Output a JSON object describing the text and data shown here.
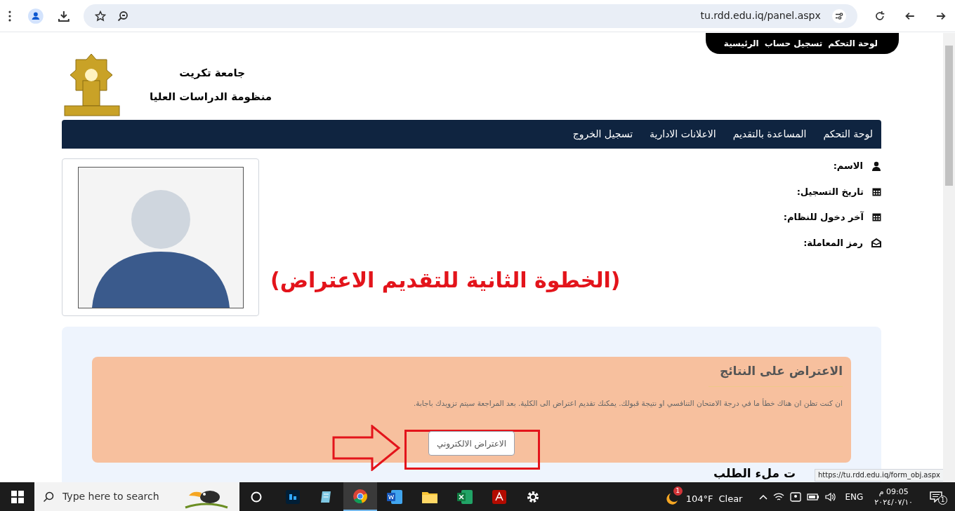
{
  "browser": {
    "url": "tu.rdd.edu.iq/panel.aspx",
    "status_url": "https://tu.rdd.edu.iq/form_obj.aspx"
  },
  "top_links": [
    "لوحة التحكم",
    "تسجيل حساب",
    "الرئيسية"
  ],
  "header": {
    "university": "جامعة تكريت",
    "system": "منظومة الدراسات العليا"
  },
  "nav": [
    "لوحة التحكم",
    "المساعدة بالتقديم",
    "الاعلانات الادارية",
    "تسجيل الخروج"
  ],
  "profile_fields": [
    {
      "kind": "user",
      "label": "الاسم:"
    },
    {
      "kind": "calendar",
      "label": "تاريخ التسجيل:"
    },
    {
      "kind": "calendar",
      "label": "آخر دخول للنظام:"
    },
    {
      "kind": "envelope",
      "label": "رمز المعاملة:"
    }
  ],
  "annotation": "(الخطوة الثانية للتقديم الاعتراض)",
  "objection": {
    "title": "الاعتراض على النتائج",
    "text": "ان كنت تظن ان هناك خطأ ما في درجة الامتحان التنافسي او نتيجة قبولك. يمكنك تقديم اعتراض الى الكلية. بعد المراجعة سيتم تزويدك باجابة.",
    "button": "الاعتراض الالكتروني"
  },
  "next_heading": "ت ملء الطلب",
  "taskbar": {
    "search_placeholder": "Type here to search",
    "weather": "104°F",
    "weather_text": "Clear",
    "weather_badge": "1",
    "language": "ENG",
    "time": "09:05 م",
    "date": "٢٠٢٤/٠٧/١٠",
    "notification_count": "1"
  }
}
